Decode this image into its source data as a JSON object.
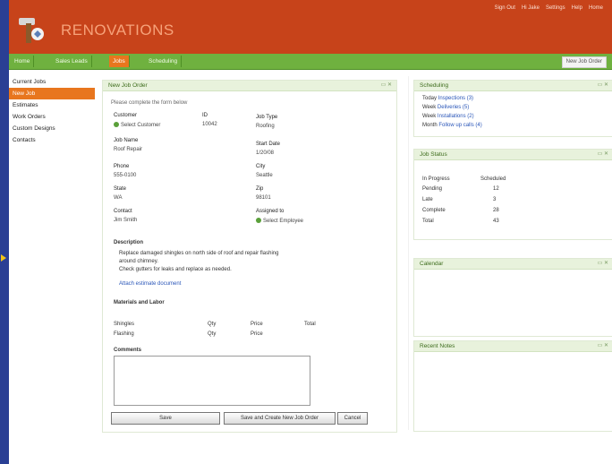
{
  "header": {
    "brand": "RENOVATIONS",
    "links": [
      "Sign Out",
      "Hi Jake",
      "Settings",
      "Help",
      "Home"
    ]
  },
  "nav": {
    "tabs": [
      "Home",
      "Sales Leads",
      "Jobs",
      "Scheduling"
    ],
    "active_index": 2,
    "right_button": "New Job Order"
  },
  "sidebar": {
    "items": [
      "Current Jobs",
      "New Job",
      "Estimates",
      "Work Orders",
      "Custom Designs",
      "Contacts"
    ],
    "active_index": 1
  },
  "job_panel": {
    "title": "New Job Order",
    "intro": "Please complete the form below",
    "fields": [
      {
        "label": "Customer",
        "value": "Select Customer"
      },
      {
        "label": "ID",
        "value": "10042"
      },
      {
        "label": "Job Type",
        "value": "Roofing"
      },
      {
        "label": "Job Name",
        "value": "Roof Repair"
      },
      {
        "label": "Start Date",
        "value": "1/20/08"
      },
      {
        "label": "Phone",
        "value": "555-0100"
      },
      {
        "label": "City",
        "value": "Seattle"
      },
      {
        "label": "State",
        "value": "WA"
      },
      {
        "label": "Zip",
        "value": "98101"
      },
      {
        "label": "Contact",
        "value": "Jim Smith"
      },
      {
        "label": "Assigned to",
        "value": "Select Employee"
      }
    ],
    "description_label": "Description",
    "description_text": "Replace damaged shingles on north side of roof and repair flashing",
    "description_text2": "around chimney.",
    "description_text3": "Check gutters for leaks and replace as needed.",
    "attach_link": "Attach estimate document",
    "materials_label": "Materials and Labor",
    "materials_rows": [
      {
        "c1": "Shingles",
        "c2": "Qty",
        "c3": "Price",
        "c4": "Total"
      },
      {
        "c1": "Flashing",
        "c2": "Qty",
        "c3": "Price",
        "c4": ""
      }
    ],
    "comments_label": "Comments",
    "buttons": {
      "save": "Save",
      "save_new": "Save and Create New Job Order",
      "cancel": "Cancel"
    }
  },
  "right_panels": {
    "scheduling": {
      "title": "Scheduling",
      "items": [
        {
          "prefix": "Today",
          "link": "Inspections (3)"
        },
        {
          "prefix": "Week",
          "link": "Deliveries (5)"
        },
        {
          "prefix": "Week",
          "link": "Installations (2)"
        },
        {
          "prefix": "Month",
          "link": "Follow up calls (4)"
        }
      ]
    },
    "job_status": {
      "title": "Job Status",
      "rows": [
        {
          "label": "In Progress",
          "value": "Scheduled"
        },
        {
          "label": "Pending",
          "value": "12"
        },
        {
          "label": "Late",
          "value": "3"
        },
        {
          "label": "Complete",
          "value": "28"
        },
        {
          "label": "Total",
          "value": "43"
        }
      ]
    },
    "calendar": {
      "title": "Calendar"
    },
    "notes": {
      "title": "Recent Notes"
    }
  },
  "colors": {
    "page_bg": "#2a3f94",
    "header": "#c7431a",
    "nav": "#6fb13f",
    "accent": "#e8761e",
    "panel_head": "#e8f2dc"
  }
}
